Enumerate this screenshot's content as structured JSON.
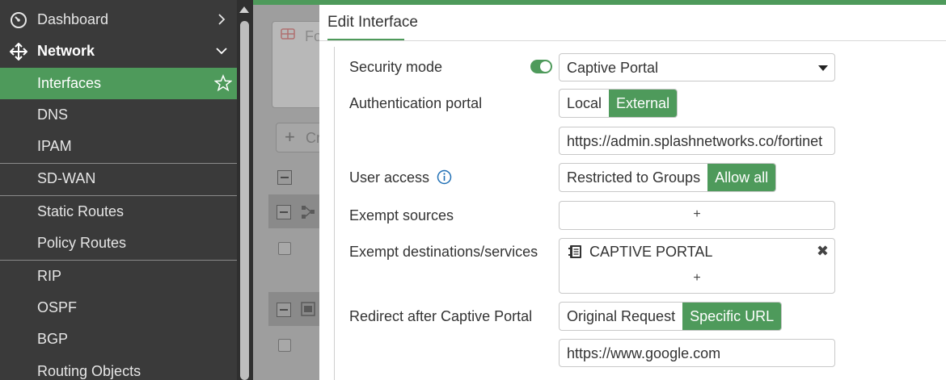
{
  "sidebar": {
    "items": [
      {
        "label": "Dashboard"
      },
      {
        "label": "Network"
      },
      {
        "label": "Interfaces"
      },
      {
        "label": "DNS"
      },
      {
        "label": "IPAM"
      },
      {
        "label": "SD-WAN"
      },
      {
        "label": "Static Routes"
      },
      {
        "label": "Policy Routes"
      },
      {
        "label": "RIP"
      },
      {
        "label": "OSPF"
      },
      {
        "label": "BGP"
      },
      {
        "label": "Routing Objects"
      }
    ]
  },
  "background": {
    "card_text": "Fo",
    "create_text": "Cr"
  },
  "dialog": {
    "title": "Edit Interface",
    "security_mode": {
      "label": "Security mode",
      "toggle_on": true,
      "value": "Captive Portal"
    },
    "auth_portal": {
      "label": "Authentication portal",
      "options": [
        "Local",
        "External"
      ],
      "selected": "External",
      "url": "https://admin.splashnetworks.co/fortinet"
    },
    "user_access": {
      "label": "User access",
      "options": [
        "Restricted to Groups",
        "Allow all"
      ],
      "selected": "Allow all"
    },
    "exempt_sources": {
      "label": "Exempt sources",
      "add": "+"
    },
    "exempt_destinations": {
      "label": "Exempt destinations/services",
      "entries": [
        "CAPTIVE PORTAL"
      ],
      "remove": "✖",
      "add": "+"
    },
    "redirect": {
      "label": "Redirect after Captive Portal",
      "options": [
        "Original Request",
        "Specific URL"
      ],
      "selected": "Specific URL",
      "url": "https://www.google.com"
    }
  },
  "colors": {
    "accent": "#4e9a5b",
    "sidebar_bg": "#3a3a3a"
  }
}
